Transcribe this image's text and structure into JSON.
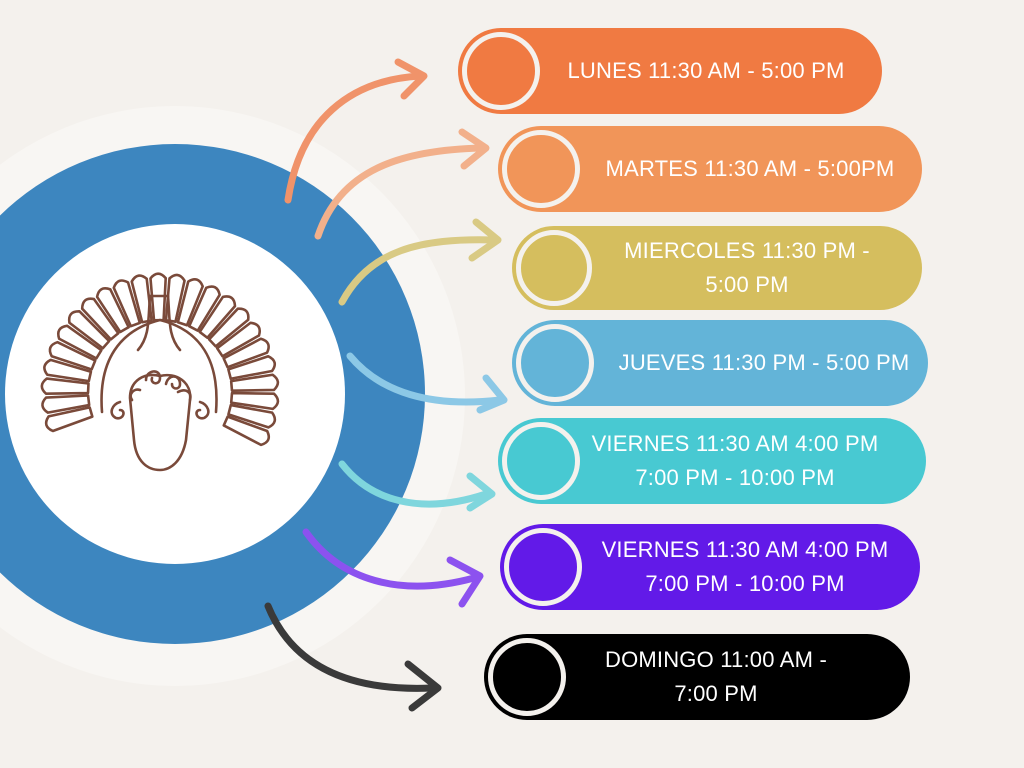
{
  "colors": {
    "background": "#f4f1ed",
    "outer_ring": "#3d86bf",
    "halo": "#f8f6f3",
    "center": "#ffffff",
    "logo_stroke": "#7a4a3a"
  },
  "logo": {
    "name": "shell-crest-icon"
  },
  "schedule": [
    {
      "text": "LUNES 11:30 AM - 5:00 PM",
      "color": "#f07a42",
      "dot": "#f07a42"
    },
    {
      "text": "MARTES 11:30 AM - 5:00PM",
      "color": "#f19559",
      "dot": "#f19559"
    },
    {
      "text": "MIERCOLES 11:30 PM -\n5:00 PM",
      "color": "#d5be5e",
      "dot": "#d5be5e"
    },
    {
      "text": "JUEVES 11:30 PM - 5:00 PM",
      "color": "#63b4d8",
      "dot": "#63b4d8"
    },
    {
      "text": "VIERNES 11:30 AM  4:00 PM\n7:00 PM - 10:00 PM",
      "color": "#48c9d2",
      "dot": "#48c9d2"
    },
    {
      "text": "VIERNES 11:30 AM  4:00 PM\n7:00 PM - 10:00 PM",
      "color": "#621ae8",
      "dot": "#621ae8"
    },
    {
      "text": "DOMINGO 11:00 AM -\n7:00 PM",
      "color": "#000000",
      "dot": "#000000"
    }
  ],
  "arrow_colors": [
    "#f0936a",
    "#f2b08b",
    "#d9ca84",
    "#8cc8e6",
    "#7fd6dd",
    "#8c52ef",
    "#3a3a3a"
  ]
}
